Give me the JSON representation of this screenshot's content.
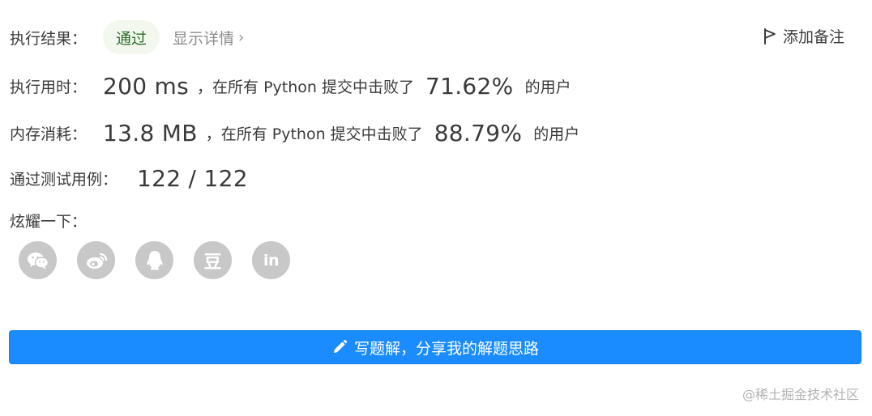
{
  "result": {
    "label": "执行结果：",
    "status": "通过",
    "details_link": "显示详情",
    "details_chevron": "›",
    "add_note": "添加备注"
  },
  "runtime": {
    "label": "执行用时：",
    "value": "200 ms",
    "middle_text": "，在所有 Python 提交中击败了",
    "percent": "71.62%",
    "suffix": "的用户"
  },
  "memory": {
    "label": "内存消耗：",
    "value": "13.8 MB",
    "middle_text": "，在所有 Python 提交中击败了",
    "percent": "88.79%",
    "suffix": "的用户"
  },
  "tests": {
    "label": "通过测试用例：",
    "value": "122 / 122"
  },
  "share": {
    "label": "炫耀一下：",
    "icons": [
      "wechat-icon",
      "weibo-icon",
      "qq-icon",
      "douban-icon",
      "linkedin-icon"
    ],
    "douban_glyph": "豆",
    "linkedin_glyph": "in"
  },
  "write_solution": {
    "label": "写题解，分享我的解题思路"
  },
  "watermark": "@稀土掘金技术社区",
  "colors": {
    "primary_button": "#1a8cff",
    "status_pill_bg": "#f3f8ef",
    "share_icon_bg": "#c8c8c8"
  }
}
